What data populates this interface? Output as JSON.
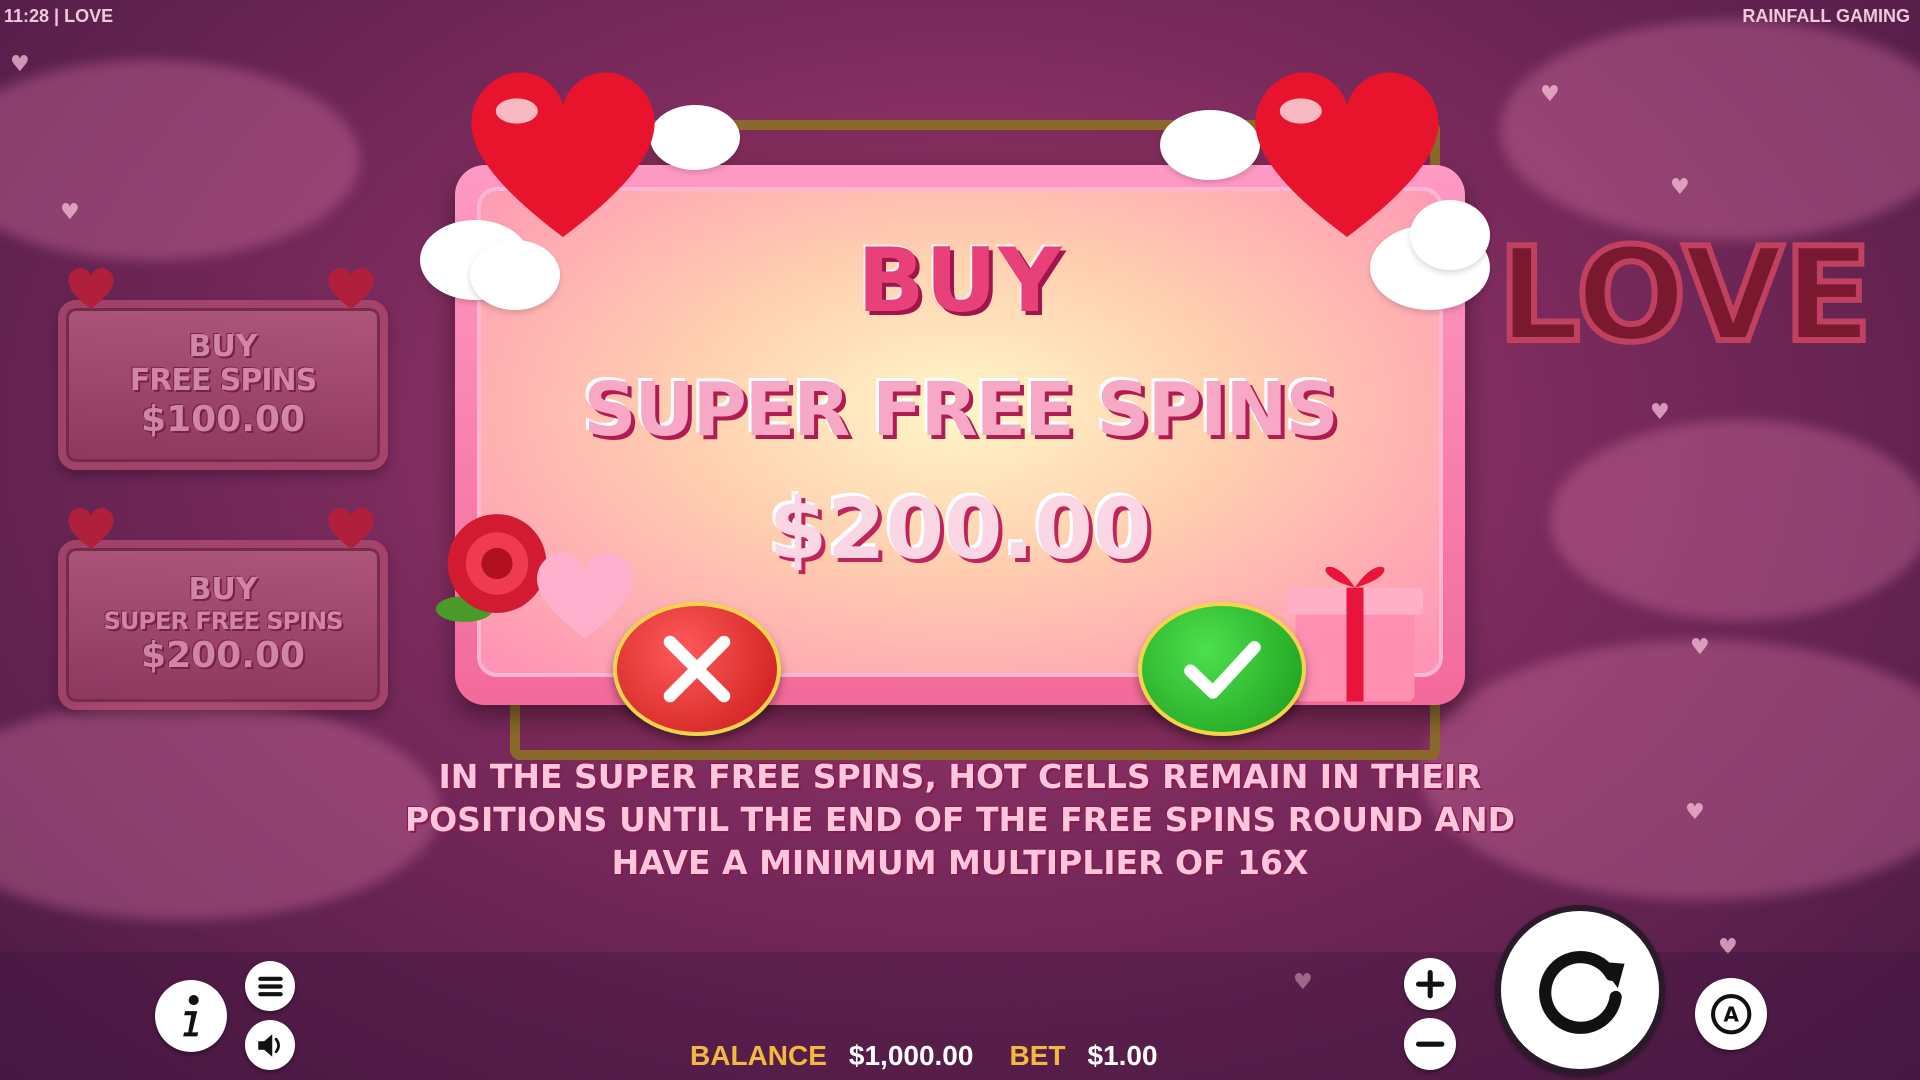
{
  "header": {
    "time_title": "11:28 | LOVE",
    "brand": "RAINFALL GAMING"
  },
  "side_panels": [
    {
      "line1": "BUY",
      "line2": "FREE SPINS",
      "price": "$100.00"
    },
    {
      "line1": "BUY",
      "line2": "SUPER FREE SPINS",
      "price": "$200.00"
    }
  ],
  "dialog": {
    "title": "BUY",
    "subtitle": "SUPER FREE SPINS",
    "price": "$200.00",
    "description": "IN THE SUPER FREE SPINS, HOT CELLS REMAIN IN THEIR POSITIONS UNTIL THE END OF THE FREE SPINS ROUND AND HAVE A MINIMUM MULTIPLIER OF 16X"
  },
  "logo_text": "LOVE",
  "status": {
    "balance_label": "BALANCE",
    "balance": "$1,000.00",
    "bet_label": "BET",
    "bet": "$1.00"
  },
  "icons": {
    "cancel": "close-icon",
    "confirm": "checkmark-icon",
    "info": "info-icon",
    "menu": "menu-icon",
    "sound": "speaker-icon",
    "plus": "plus-icon",
    "minus": "minus-icon",
    "spin": "spin-icon",
    "auto": "autoplay-icon"
  },
  "colors": {
    "accent_pink": "#e8417a",
    "cancel_red": "#c81818",
    "confirm_green": "#1a9a1a",
    "label_gold": "#f2b840"
  }
}
